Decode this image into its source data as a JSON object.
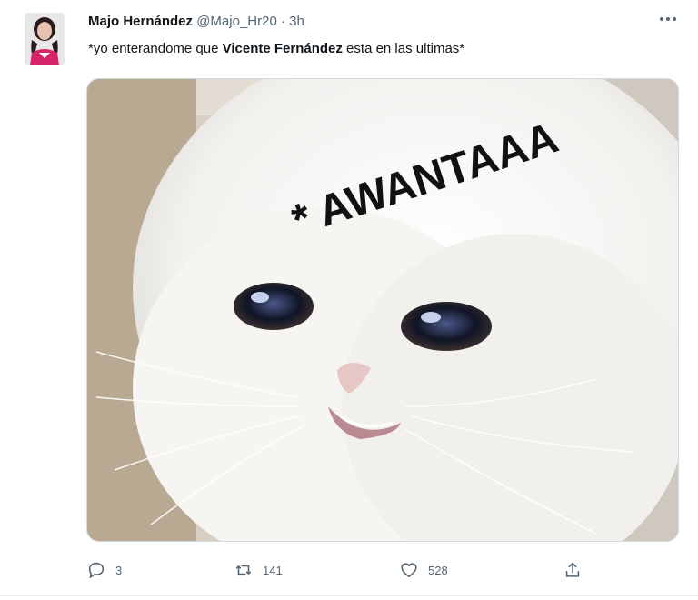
{
  "tweet": {
    "author_name": "Majo Hernández",
    "handle": "@Majo_Hr20",
    "separator": "·",
    "time": "3h",
    "text_before": "*yo enterandome que ",
    "text_bold": "Vicente Fernández",
    "text_after": " esta en las ultimas*",
    "image_caption": "* AWANTAAA"
  },
  "actions": {
    "reply_count": "3",
    "retweet_count": "141",
    "like_count": "528"
  },
  "icons": {
    "more": "more-options-icon",
    "reply": "reply-icon",
    "retweet": "retweet-icon",
    "like": "heart-icon",
    "share": "share-icon"
  },
  "colors": {
    "text": "#0f1419",
    "muted": "#536471",
    "avatar_accent": "#d6266b"
  }
}
